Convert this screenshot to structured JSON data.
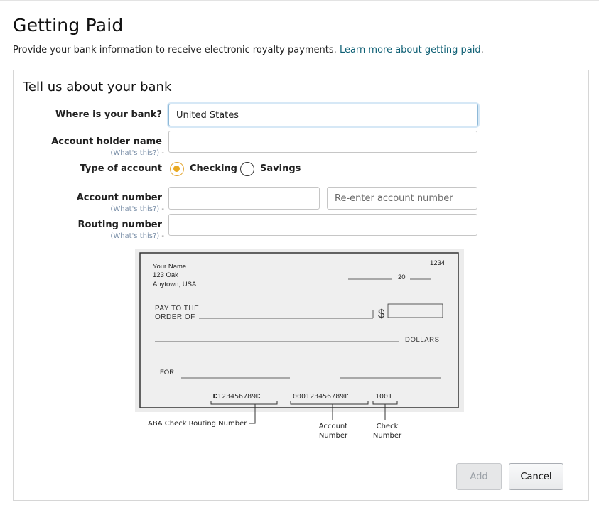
{
  "page": {
    "title": "Getting Paid",
    "intro_text": "Provide your bank information to receive electronic royalty payments.",
    "intro_link": "Learn more about getting paid",
    "intro_suffix": "."
  },
  "form": {
    "section_title": "Tell us about your bank",
    "bank_location_label": "Where is your bank?",
    "bank_location_value": "United States",
    "holder_label": "Account holder name",
    "holder_value": "",
    "help_text": "(What's this?)",
    "account_type_label": "Type of account",
    "account_types": [
      {
        "label": "Checking",
        "selected": true
      },
      {
        "label": "Savings",
        "selected": false
      }
    ],
    "account_number_label": "Account number",
    "account_number_value": "",
    "reenter_placeholder": "Re-enter account number",
    "routing_label": "Routing number",
    "routing_value": ""
  },
  "check": {
    "name": "Your Name",
    "street": "123 Oak",
    "city": "Anytown, USA",
    "number": "1234",
    "date_prefix": "20",
    "pay_line1": "PAY TO THE",
    "pay_line2": "ORDER OF",
    "dollar_sign": "$",
    "dollars": "DOLLARS",
    "for": "FOR",
    "micr_routing": "⑆123456789⑆",
    "micr_account": "000123456789⑈",
    "micr_check": "1001",
    "caption_routing": "ABA Check Routing Number",
    "caption_account_1": "Account",
    "caption_account_2": "Number",
    "caption_check_1": "Check",
    "caption_check_2": "Number"
  },
  "buttons": {
    "add": "Add",
    "cancel": "Cancel"
  },
  "colors": {
    "link": "#0e5f74",
    "radio_selected": "#e9a922",
    "help_text": "#7a8fa8",
    "focus_border": "#8eb9d8"
  }
}
